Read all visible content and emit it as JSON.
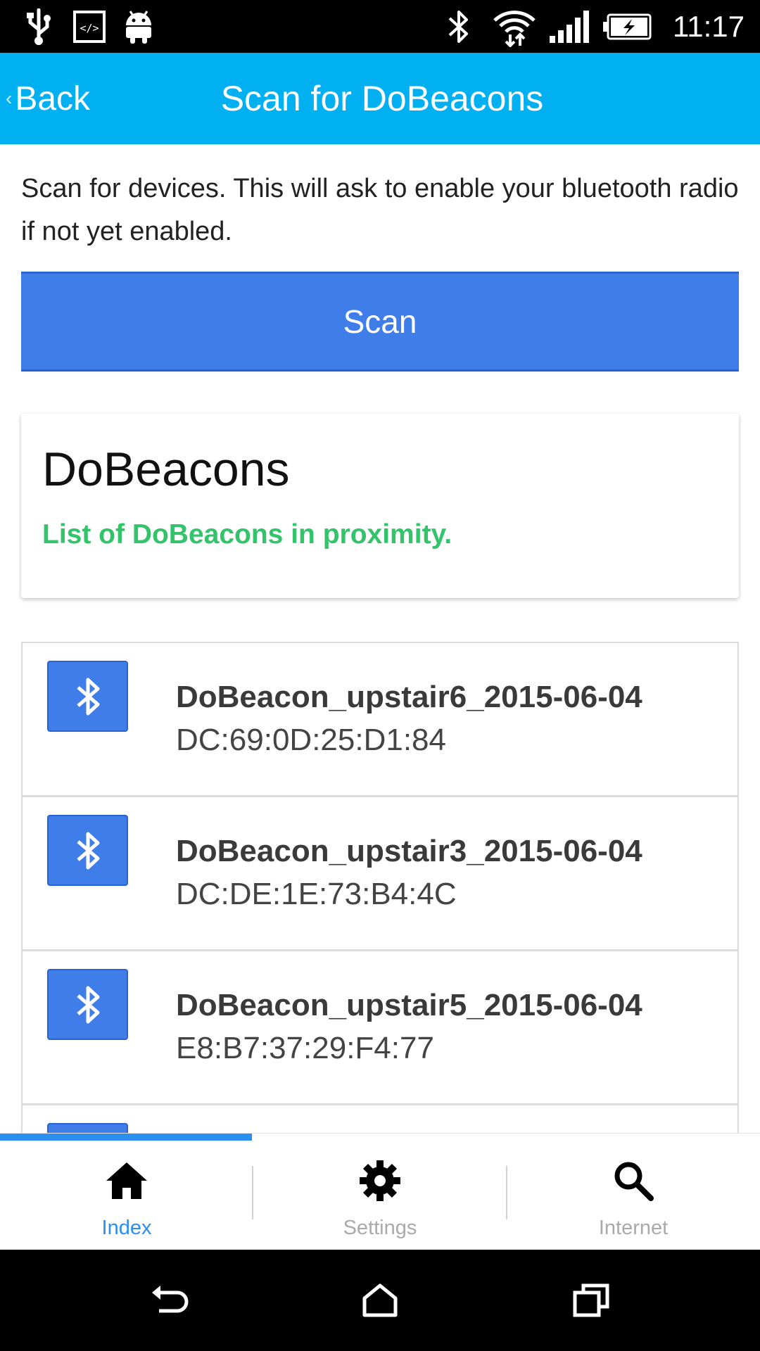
{
  "status_bar": {
    "time": "11:17",
    "icons": [
      "usb-icon",
      "developer-icon",
      "android-icon",
      "bluetooth-icon",
      "wifi-icon",
      "signal-icon",
      "battery-icon"
    ]
  },
  "header": {
    "back_label": "Back",
    "title": "Scan for DoBeacons",
    "color": "#00b0f0"
  },
  "intro_text": "Scan for devices. This will ask to enable your bluetooth radio if not yet enabled.",
  "scan_button": {
    "label": "Scan",
    "color": "#3f7ee8"
  },
  "card": {
    "title": "DoBeacons",
    "subtitle": "List of DoBeacons in proximity.",
    "subtitle_color": "#33c36a"
  },
  "devices": [
    {
      "name": "DoBeacon_upstair6_2015-06-04",
      "mac": "DC:69:0D:25:D1:84",
      "icon": "bluetooth-icon"
    },
    {
      "name": "DoBeacon_upstair3_2015-06-04",
      "mac": "DC:DE:1E:73:B4:4C",
      "icon": "bluetooth-icon"
    },
    {
      "name": "DoBeacon_upstair5_2015-06-04",
      "mac": "E8:B7:37:29:F4:77",
      "icon": "bluetooth-icon"
    }
  ],
  "tabs": [
    {
      "label": "Index",
      "icon": "home-icon",
      "active": true
    },
    {
      "label": "Settings",
      "icon": "gear-icon",
      "active": false
    },
    {
      "label": "Internet",
      "icon": "search-icon",
      "active": false
    }
  ],
  "nav_bar": {
    "buttons": [
      "back-icon",
      "home-icon",
      "recents-icon"
    ]
  }
}
